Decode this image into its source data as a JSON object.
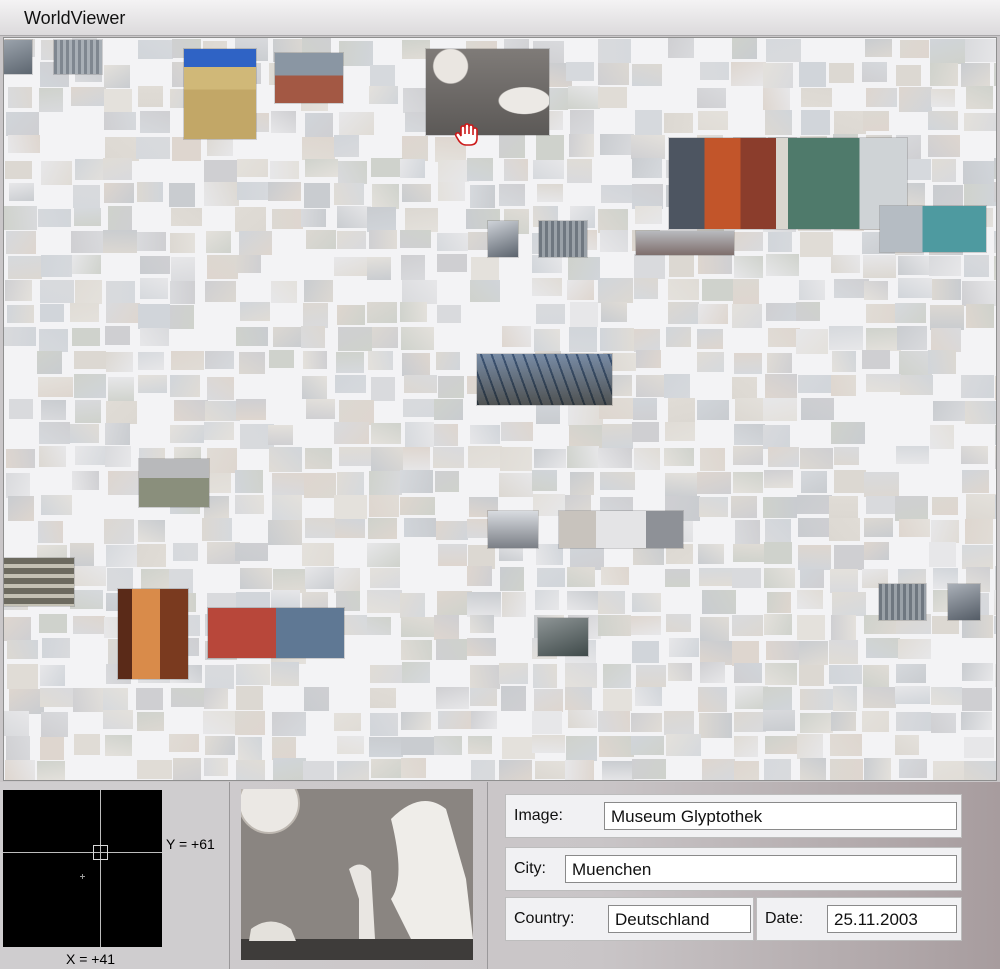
{
  "window": {
    "title": "WorldViewer"
  },
  "navigator": {
    "y_readout": "Y = +61",
    "x_readout": "X = +41"
  },
  "details": {
    "image_label": "Image:",
    "image_value": "Museum Glyptothek",
    "city_label": "City:",
    "city_value": "Muenchen",
    "country_label": "Country:",
    "country_value": "Deutschland",
    "date_label": "Date:",
    "date_value": "25.11.2003"
  },
  "colors": {
    "canvas_bg": "#f3f3f5",
    "navigator_bg": "#000000",
    "cursor_red": "#cc1a1a"
  }
}
